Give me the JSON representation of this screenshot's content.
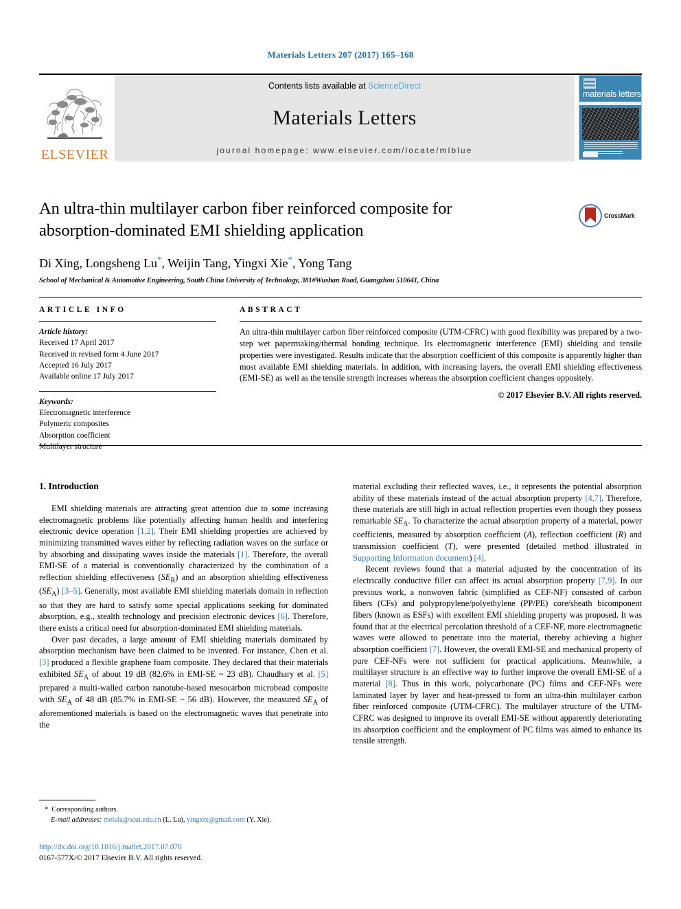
{
  "running_head": "Materials Letters 207 (2017) 165–168",
  "masthead": {
    "publisher_name": "ELSEVIER",
    "contents_prefix": "Contents lists available at ",
    "contents_link": "ScienceDirect",
    "journal_name": "Materials Letters",
    "homepage_line": "journal homepage: www.elsevier.com/locate/mlblue",
    "cover_title": "materials letters"
  },
  "title": {
    "line1": "An ultra-thin multilayer carbon fiber reinforced composite for",
    "line2": "absorption-dominated EMI shielding application",
    "crossmark_label": "CrossMark"
  },
  "authors": {
    "a1": "Di Xing, Longsheng Lu",
    "a2": ", Weijin Tang, Yingxi Xie",
    "a3": ", Yong Tang",
    "star": "*",
    "affiliation": "School of Mechanical & Automotive Engineering, South China University of Technology, 381#Wushan Road, Guangzhou 510641, China"
  },
  "article_info": {
    "heading": "ARTICLE INFO",
    "history_label": "Article history:",
    "history": [
      "Received 17 April 2017",
      "Received in revised form 4 June 2017",
      "Accepted 16 July 2017",
      "Available online 17 July 2017"
    ],
    "keywords_label": "Keywords:",
    "keywords": [
      "Electromagnetic interference",
      "Polymeric composites",
      "Absorption coefficient",
      "Multilayer structure"
    ]
  },
  "abstract": {
    "heading": "ABSTRACT",
    "text": "An ultra-thin multilayer carbon fiber reinforced composite (UTM-CFRC) with good flexibility was prepared by a two-step wet papermaking/thermal bonding technique. Its electromagnetic interference (EMI) shielding and tensile properties were investigated. Results indicate that the absorption coefficient of this composite is apparently higher than most available EMI shielding materials. In addition, with increasing layers, the overall EMI shielding effectiveness (EMI-SE) as well as the tensile strength increases whereas the absorption coefficient changes oppositely.",
    "copyright": "© 2017 Elsevier B.V. All rights reserved."
  },
  "body": {
    "section1_heading": "1. Introduction",
    "left": {
      "p1_a": "EMI shielding materials are attracting great attention due to some increasing electromagnetic problems like potentially affecting human health and interfering electronic device operation ",
      "p1_ref1": "[1,2]",
      "p1_b": ". Their EMI shielding properties are achieved by minimizing transmitted waves either by reflecting radiation waves on the surface or by absorbing and dissipating waves inside the materials ",
      "p1_ref2": "[1]",
      "p1_c": ". Therefore, the overall EMI-SE of a material is conventionally characterized by the combination of a reflection shielding effectiveness (",
      "p1_var1": "SE",
      "p1_sub1": "R",
      "p1_d": ") and an absorption shielding effectiveness (",
      "p1_var2": "SE",
      "p1_sub2": "A",
      "p1_e": ") ",
      "p1_ref3": "[3–5]",
      "p1_f": ". Generally, most available EMI shielding materials domain in reflection so that they are hard to satisfy some special applications seeking for dominated absorption, e.g., stealth technology and precision electronic devices ",
      "p1_ref4": "[6]",
      "p1_g": ". Therefore, there exists a critical need for absorption-dominated EMI shielding materials.",
      "p2_a": "Over past decades, a large amount of EMI shielding materials dominated by absorption mechanism have been claimed to be invented. For instance, Chen et al. ",
      "p2_ref1": "[3]",
      "p2_b": " produced a flexible graphene foam composite. They declared that their materials exhibited ",
      "p2_var1": "SE",
      "p2_sub1": "A",
      "p2_c": " of about 19 dB (82.6% in EMI-SE ~ 23 dB). Chaudhary et al. ",
      "p2_ref2": "[5]",
      "p2_d": " prepared a multi-walled carbon nanotube-based mesocarbon microbead composite with ",
      "p2_var2": "SE",
      "p2_sub2": "A",
      "p2_e": " of 48 dB (85.7% in EMI-SE ~ 56 dB). However, the measured ",
      "p2_var3": "SE",
      "p2_sub3": "A",
      "p2_f": " of aforementioned materials is based on the electromagnetic waves that penetrate into the"
    },
    "right": {
      "p3_a": "material excluding their reflected waves, i.e., it represents the potential absorption ability of these materials instead of the actual absorption property ",
      "p3_ref1": "[4,7]",
      "p3_b": ". Therefore, these materials are still high in actual reflection properties even though they possess remarkable ",
      "p3_var1": "SE",
      "p3_sub1": "A",
      "p3_c": ". To characterize the actual absorption property of a material, power coefficients, measured by absorption coefficient (",
      "p3_var2": "A",
      "p3_d": "), reflection coefficient (",
      "p3_var3": "R",
      "p3_e": ") and transmission coefficient (",
      "p3_var4": "T",
      "p3_f": "), were presented (detailed method illustrated in ",
      "p3_link": "Supporting Information document",
      "p3_g": ") ",
      "p3_ref2": "[4]",
      "p3_h": ".",
      "p4_a": "Recent reviews found that a material adjusted by the concentration of its electrically conductive filler can affect its actual absorption property ",
      "p4_ref1": "[7,9]",
      "p4_b": ". In our previous work, a nonwoven fabric (simplified as CEF-NF) consisted of carbon fibers (CFs) and polypropylene/polyethylene (PP/PE) core/sheath bicomponent fibers (known as ESFs) with excellent EMI shielding property was proposed. It was found that at the electrical percolation threshold of a CEF-NF, more electromagnetic waves were allowed to penetrate into the material, thereby achieving a higher absorption coefficient ",
      "p4_ref2": "[7]",
      "p4_c": ". However, the overall EMI-SE and mechanical property of pure CEF-NFs were not sufficient for practical applications. Meanwhile, a multilayer structure is an effective way to further improve the overall EMI-SE of a material ",
      "p4_ref3": "[8]",
      "p4_d": ". Thus in this work, polycarbonate (PC) films and CEF-NFs were laminated layer by layer and heat-pressed to form an ultra-thin multilayer carbon fiber reinforced composite (UTM-CFRC). The multilayer structure of the UTM-CFRC was designed to improve its overall EMI-SE without apparently deteriorating its absorption coefficient and the employment of PC films was aimed to enhance its tensile strength."
    }
  },
  "footnote": {
    "star": "*",
    "corresponding": "Corresponding authors.",
    "email_label": "E-mail addresses:",
    "email1": "melula@scut.edu.cn",
    "email1_who": " (L. Lu), ",
    "email2": "yingxix@gmail.com",
    "email2_who": " (Y. Xie)."
  },
  "doi": {
    "url": "http://dx.doi.org/10.1016/j.matlet.2017.07.070",
    "issn": "0167-577X/© 2017 Elsevier B.V. All rights reserved."
  },
  "colors": {
    "link_blue": "#2b7bb9",
    "header_blue": "#1a6ea8",
    "sciencedirect_blue": "#59a6d4",
    "elsevier_orange": "#E87722",
    "cover_blue": "#3a86b5"
  }
}
